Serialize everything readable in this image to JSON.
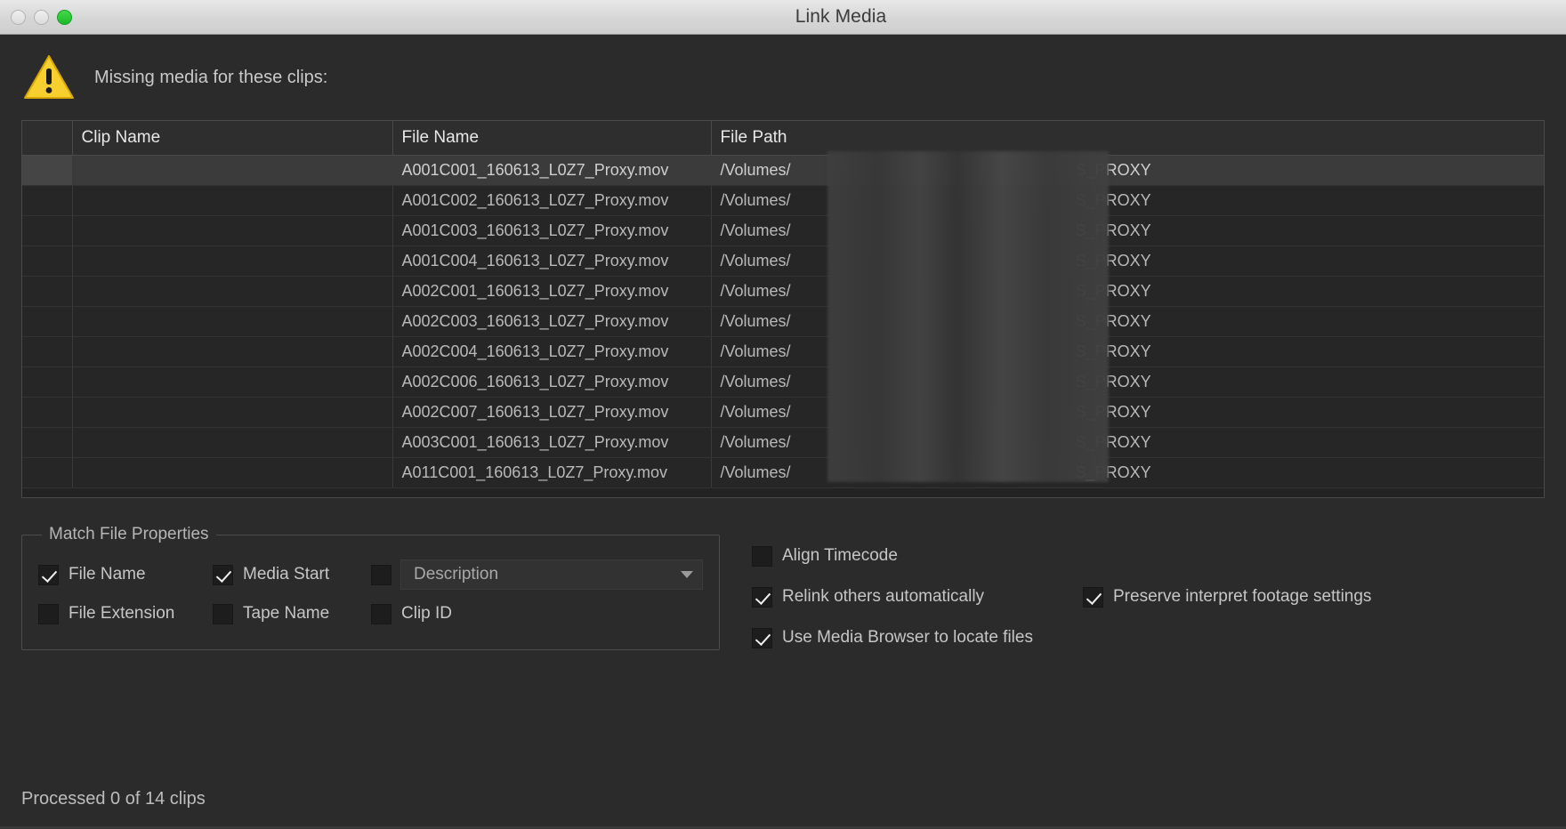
{
  "window": {
    "title": "Link Media",
    "controls": [
      "close",
      "minimize",
      "zoom"
    ]
  },
  "warning": {
    "icon": "warning-triangle-icon",
    "message": "Missing media for these clips:"
  },
  "table": {
    "columns": [
      "",
      "Clip Name",
      "File Name",
      "File Path"
    ],
    "rows": [
      {
        "clip_name": "",
        "file_name": "A001C001_160613_L0Z7_Proxy.mov",
        "path_prefix": "/Volumes/",
        "path_suffix": "S_PROXY",
        "selected": true
      },
      {
        "clip_name": "",
        "file_name": "A001C002_160613_L0Z7_Proxy.mov",
        "path_prefix": "/Volumes/",
        "path_suffix": "S_PROXY",
        "selected": false
      },
      {
        "clip_name": "",
        "file_name": "A001C003_160613_L0Z7_Proxy.mov",
        "path_prefix": "/Volumes/",
        "path_suffix": "S_PROXY",
        "selected": false
      },
      {
        "clip_name": "",
        "file_name": "A001C004_160613_L0Z7_Proxy.mov",
        "path_prefix": "/Volumes/",
        "path_suffix": "S_PROXY",
        "selected": false
      },
      {
        "clip_name": "",
        "file_name": "A002C001_160613_L0Z7_Proxy.mov",
        "path_prefix": "/Volumes/",
        "path_suffix": "S_PROXY",
        "selected": false
      },
      {
        "clip_name": "",
        "file_name": "A002C003_160613_L0Z7_Proxy.mov",
        "path_prefix": "/Volumes/",
        "path_suffix": "S_PROXY",
        "selected": false
      },
      {
        "clip_name": "",
        "file_name": "A002C004_160613_L0Z7_Proxy.mov",
        "path_prefix": "/Volumes/",
        "path_suffix": "S_PROXY",
        "selected": false
      },
      {
        "clip_name": "",
        "file_name": "A002C006_160613_L0Z7_Proxy.mov",
        "path_prefix": "/Volumes/",
        "path_suffix": "S_PROXY",
        "selected": false
      },
      {
        "clip_name": "",
        "file_name": "A002C007_160613_L0Z7_Proxy.mov",
        "path_prefix": "/Volumes/",
        "path_suffix": "S_PROXY",
        "selected": false
      },
      {
        "clip_name": "",
        "file_name": "A003C001_160613_L0Z7_Proxy.mov",
        "path_prefix": "/Volumes/",
        "path_suffix": "S_PROXY",
        "selected": false
      },
      {
        "clip_name": "",
        "file_name": "A011C001_160613_L0Z7_Proxy.mov",
        "path_prefix": "/Volumes/",
        "path_suffix": "S_PROXY",
        "selected": false
      }
    ]
  },
  "match_file_properties": {
    "legend": "Match File Properties",
    "file_name": {
      "label": "File Name",
      "checked": true
    },
    "media_start": {
      "label": "Media Start",
      "checked": true
    },
    "metadata_toggle": {
      "checked": false
    },
    "metadata_dropdown": {
      "value": "Description"
    },
    "file_extension": {
      "label": "File Extension",
      "checked": false
    },
    "tape_name": {
      "label": "Tape Name",
      "checked": false
    },
    "clip_id": {
      "label": "Clip ID",
      "checked": false
    }
  },
  "link_options": {
    "align_timecode": {
      "label": "Align Timecode",
      "checked": false
    },
    "relink_others": {
      "label": "Relink others automatically",
      "checked": true
    },
    "preserve_interpret": {
      "label": "Preserve interpret footage settings",
      "checked": true
    },
    "use_media_browser": {
      "label": "Use Media Browser to locate files",
      "checked": true
    }
  },
  "status": {
    "text": "Processed 0 of 14 clips"
  },
  "colors": {
    "window_bg": "#2b2b2b",
    "titlebar": "#d6d6d6",
    "warning_yellow": "#f5c518",
    "zoom_green": "#2ec62f",
    "selected_row": "#3b3b3b",
    "text": "#c6c6c6"
  }
}
